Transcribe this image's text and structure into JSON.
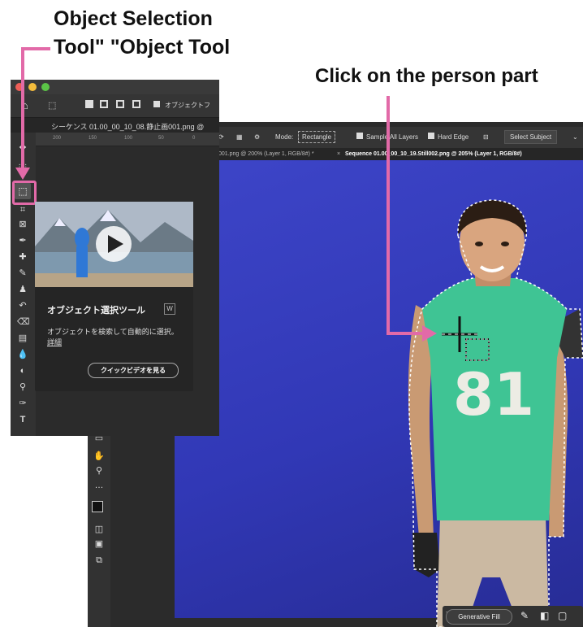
{
  "annotations": {
    "left_title_line1": "Object Selection",
    "left_title_line2": "Tool\" \"Object Tool",
    "right_title": "Click on the person part",
    "arrow_color": "#e26aa8"
  },
  "back_window": {
    "options": {
      "mode_label": "Mode:",
      "mode_value": "Rectangle",
      "sample_all_layers": "Sample All Layers",
      "hard_edge": "Hard Edge",
      "select_subject": "Select Subject"
    },
    "tabs": [
      {
        "label": "001.png @ 200% (Layer 1, RGB/8#) *"
      },
      {
        "label": "Sequence 01.00_00_10_19.Still002.png @ 205% (Layer 1, RGB/8#)"
      }
    ],
    "context_bar": {
      "generative_fill": "Generative Fill"
    },
    "jersey_number": "81",
    "canvas_color": "#3a41c2"
  },
  "front_window": {
    "tab_label": "シーケンス 01.00_00_10_08.静止画001.png @",
    "options_label": "オブジェクトフ",
    "ruler_ticks": [
      "200",
      "150",
      "100",
      "50",
      "0"
    ],
    "popup": {
      "title": "オブジェクト選択ツール",
      "shortcut": "W",
      "description": "オブジェクトを検索して自動的に選択。",
      "learn_more": "詳細",
      "video_button": "クイックビデオを見る"
    }
  }
}
